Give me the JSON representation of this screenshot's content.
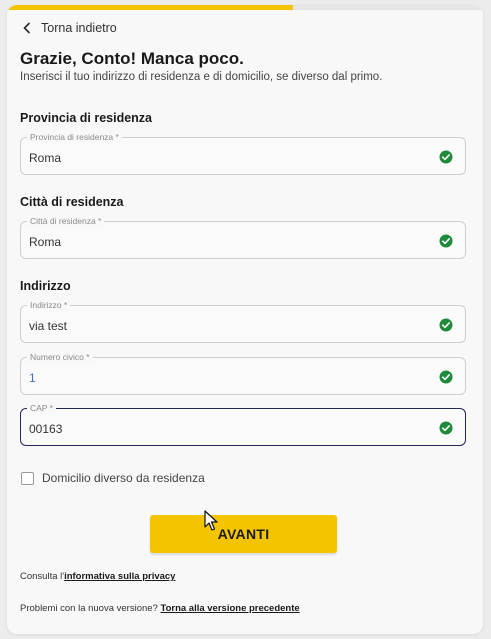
{
  "progress": {
    "fraction": 0.6
  },
  "nav": {
    "back_label": "Torna indietro"
  },
  "header": {
    "title": "Grazie, Conto! Manca poco.",
    "subtitle": "Inserisci il tuo indirizzo di residenza e di domicilio, se diverso dal primo."
  },
  "sections": {
    "provincia": "Provincia di residenza",
    "citta": "Città di residenza",
    "indirizzo": "Indirizzo"
  },
  "fields": {
    "provincia": {
      "label": "Provincia di residenza *",
      "value": "Roma"
    },
    "citta": {
      "label": "Città di residenza *",
      "value": "Roma"
    },
    "indirizzo": {
      "label": "Indirizzo *",
      "value": "via test"
    },
    "civico": {
      "label": "Numero civico *",
      "value": "1"
    },
    "cap": {
      "label": "CAP *",
      "value": "00163"
    }
  },
  "domicilio": {
    "label": "Domicilio diverso da residenza",
    "checked": false
  },
  "cta": {
    "label": "AVANTI"
  },
  "privacy": {
    "prefix": "Consulta l'",
    "link": "informativa sulla privacy"
  },
  "legacy": {
    "prefix": "Problemi con la nuova versione? ",
    "link": "Torna alla versione precedente"
  },
  "colors": {
    "accent": "#f5c400",
    "valid": "#1f8a3b",
    "focus_border": "#24275a"
  },
  "icons": {
    "back": "chevron-left-icon",
    "valid": "check-circle-icon",
    "pointer": "mouse-cursor-icon"
  }
}
